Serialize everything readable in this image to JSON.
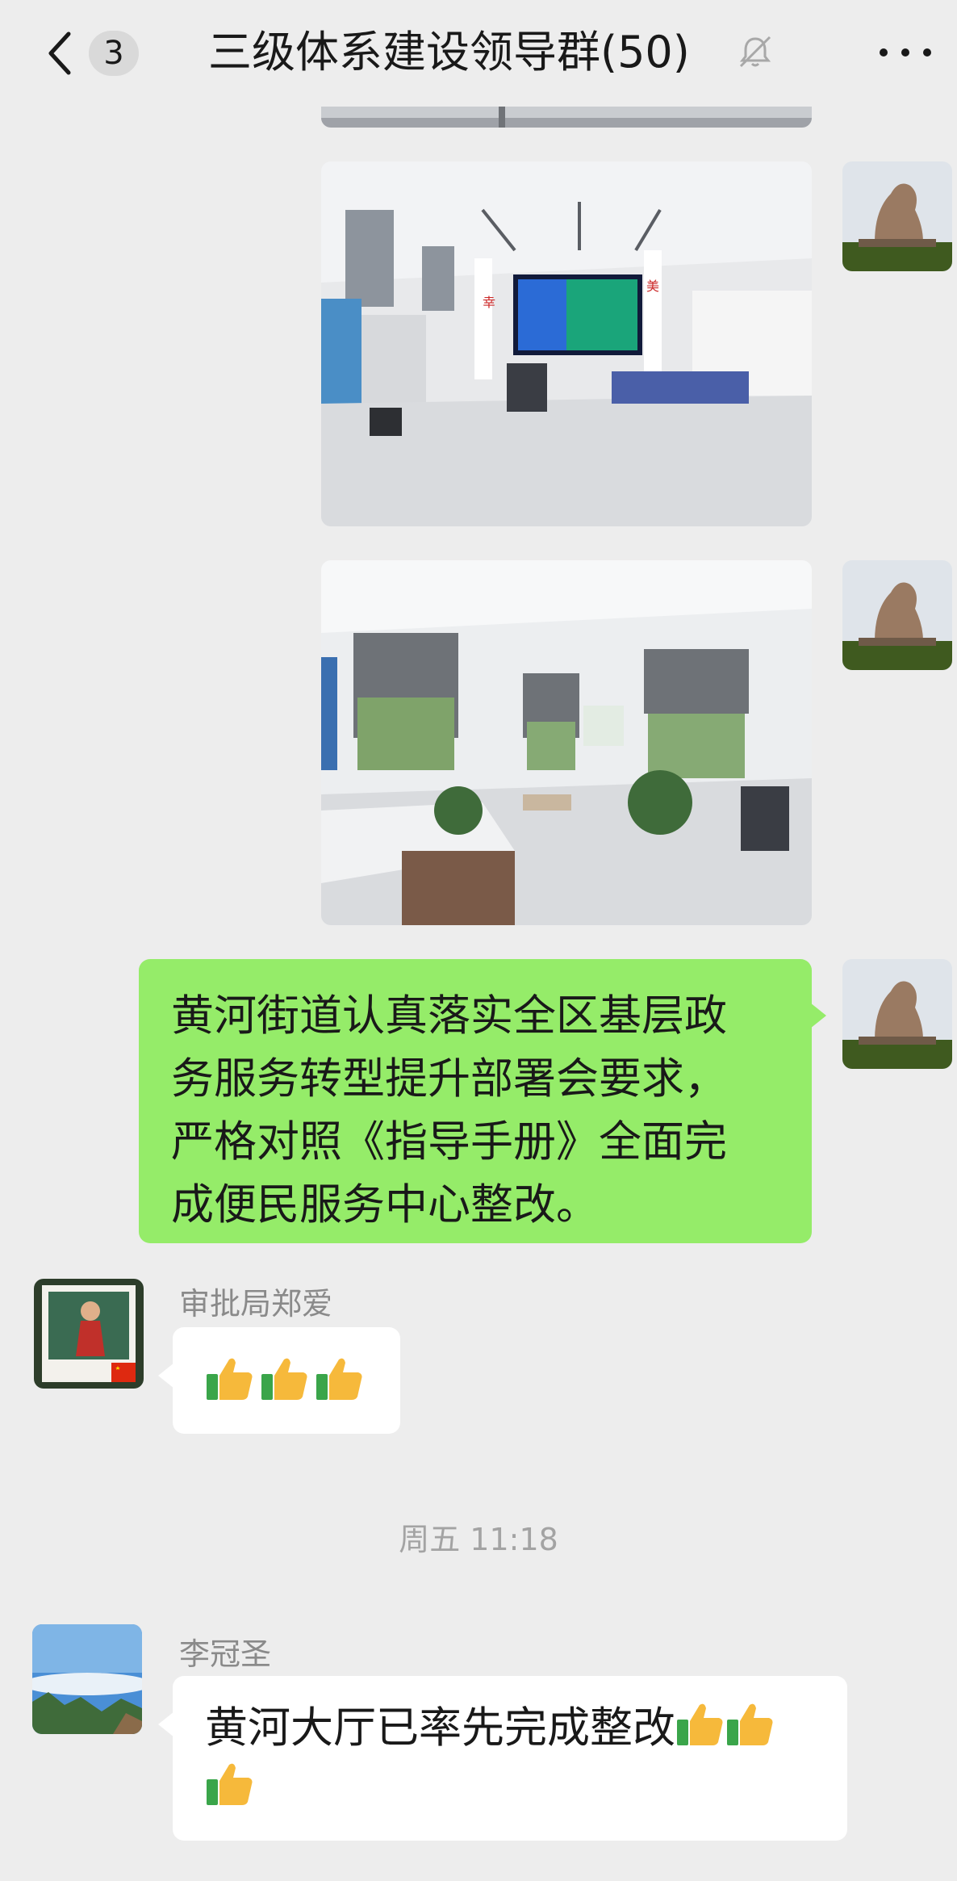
{
  "header": {
    "back_label": "<",
    "unread_count": "3",
    "title": "三级体系建设领导群(50)",
    "mute_icon": "bell-muted-icon",
    "more_icon": "more-dots-icon"
  },
  "messages": [
    {
      "type": "image",
      "side": "right",
      "icon": "photo-service-hall"
    },
    {
      "type": "image",
      "side": "right",
      "icon": "photo-service-office"
    },
    {
      "type": "text",
      "side": "right",
      "lines": [
        "黄河街道认真落实全区基层政",
        "务服务转型提升部署会要求，",
        "严格对照《指导手册》全面完",
        "成便民服务中心整改。"
      ]
    },
    {
      "type": "emoji",
      "side": "left",
      "sender": "审批局郑爱",
      "emoji": "👍👍👍"
    },
    {
      "type": "text",
      "side": "left",
      "sender": "李冠圣",
      "lines": [
        "黄河大厅已率先完成整改👍👍",
        "👍"
      ]
    }
  ],
  "timestamp": "周五 11:18",
  "colors": {
    "background": "#ededed",
    "my_bubble": "#95ec69",
    "other_bubble": "#ffffff"
  }
}
